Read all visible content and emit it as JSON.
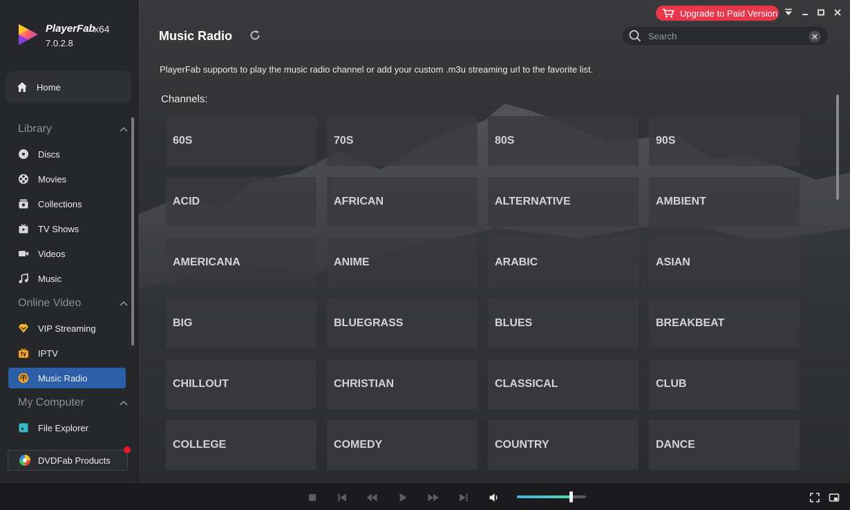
{
  "app": {
    "name": "PlayerFab",
    "arch": "x64",
    "version": "7.0.2.8"
  },
  "header": {
    "title": "Music Radio",
    "upgrade_label": "Upgrade to Paid Version",
    "search_placeholder": "Search"
  },
  "sidebar": {
    "home_label": "Home",
    "sections": [
      {
        "title": "Library",
        "items": [
          "Discs",
          "Movies",
          "Collections",
          "TV Shows",
          "Videos",
          "Music"
        ]
      },
      {
        "title": "Online Video",
        "items": [
          "VIP Streaming",
          "IPTV",
          "Music Radio"
        ]
      },
      {
        "title": "My Computer",
        "items": [
          "File Explorer"
        ]
      }
    ],
    "active_item": "Music Radio",
    "products_label": "DVDFab Products"
  },
  "main": {
    "description": "PlayerFab supports to play the music radio channel or add your custom .m3u streaming url to the favorite list.",
    "channels_label": "Channels:",
    "channels": [
      "60S",
      "70S",
      "80S",
      "90S",
      "ACID",
      "AFRICAN",
      "ALTERNATIVE",
      "AMBIENT",
      "AMERICANA",
      "ANIME",
      "ARABIC",
      "ASIAN",
      "BIG",
      "BLUEGRASS",
      "BLUES",
      "BREAKBEAT",
      "CHILLOUT",
      "CHRISTIAN",
      "CLASSICAL",
      "CLUB",
      "COLLEGE",
      "COMEDY",
      "COUNTRY",
      "DANCE"
    ]
  },
  "player": {
    "volume_fraction": 0.78
  },
  "colors": {
    "accent": "#2d5ea8",
    "upgrade": "#e8364a",
    "notification": "#e8192c"
  },
  "icons": {
    "home": "home-icon",
    "discs": "disc-icon",
    "movies": "film-reel-icon",
    "collections": "collection-icon",
    "tv_shows": "tv-icon",
    "videos": "video-camera-icon",
    "music": "music-note-icon",
    "vip_streaming": "diamond-icon",
    "iptv": "iptv-icon",
    "music_radio": "radio-icon",
    "file_explorer": "folder-icon",
    "products": "dvdfab-logo-icon"
  }
}
